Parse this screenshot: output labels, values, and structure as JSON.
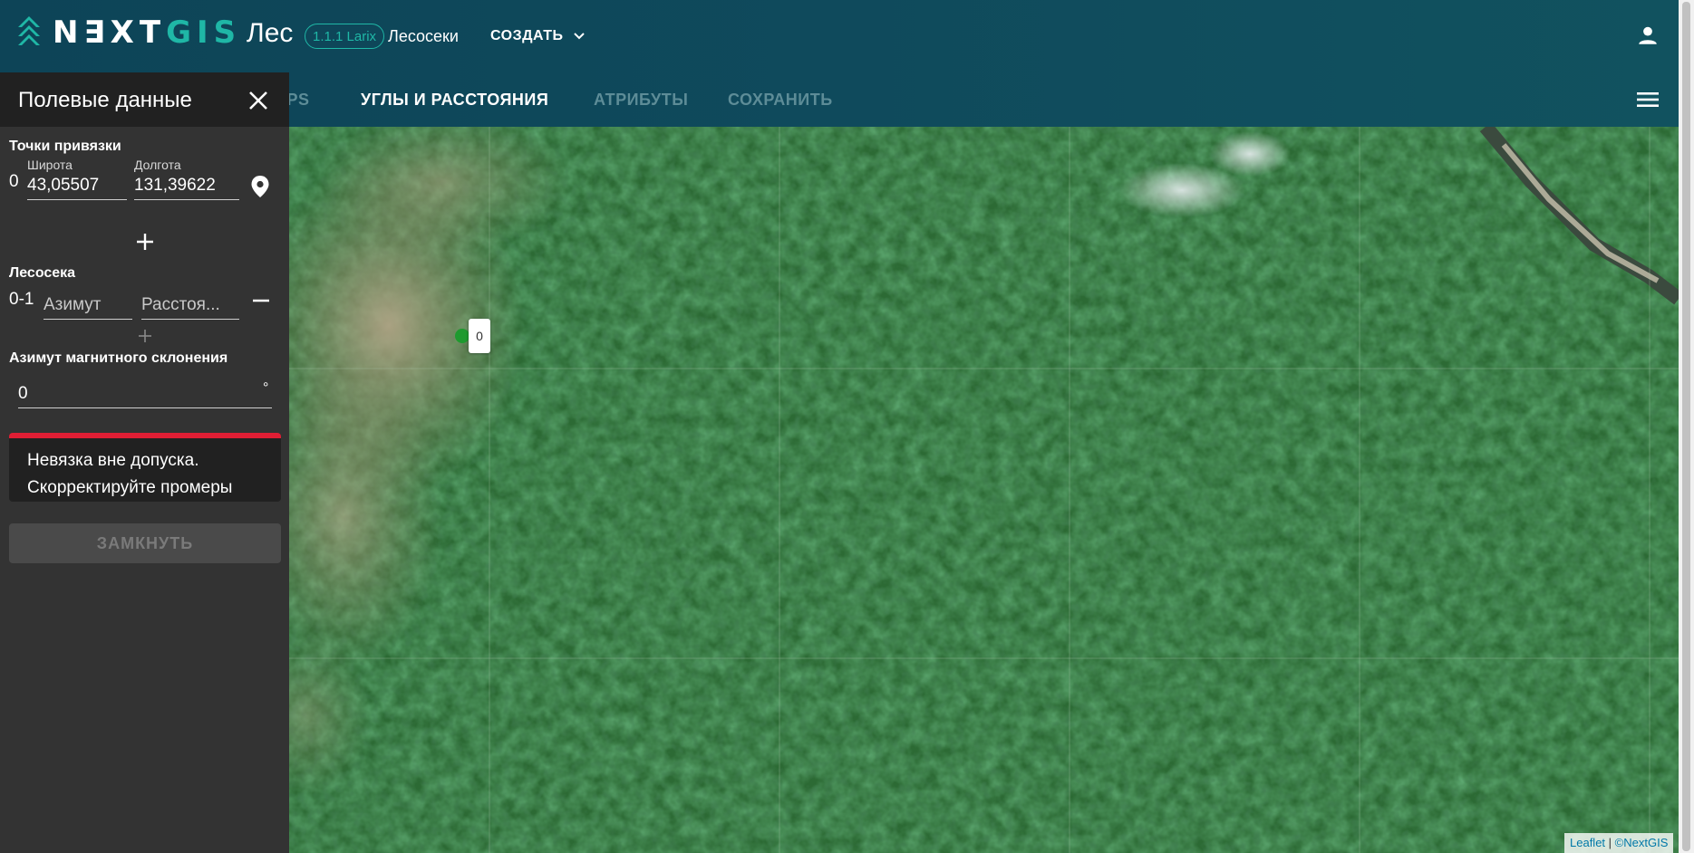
{
  "header": {
    "logo": {
      "part1": "N∃XT",
      "part2": "GIS",
      "icon": "nextgis-tree-icon"
    },
    "app_title": "Лес",
    "version": "1.1.1 Larix",
    "nav_link": "Лесосеки",
    "create_menu": {
      "label": "СОЗДАТЬ",
      "icon": "chevron-down-icon"
    },
    "user_icon": "account-icon",
    "menu_icon": "hamburger-menu-icon"
  },
  "tabs": [
    {
      "label": "GPS",
      "active": false
    },
    {
      "label": "УГЛЫ И РАССТОЯНИЯ",
      "active": true
    },
    {
      "label": "АТРИБУТЫ",
      "active": false
    },
    {
      "label": "СОХРАНИТЬ",
      "active": false
    }
  ],
  "panel": {
    "title": "Полевые данные",
    "close_icon": "close-icon",
    "anchor_points": {
      "label": "Точки привязки",
      "rows": [
        {
          "index": "0",
          "lat_label": "Широта",
          "lat_value": "43,05507",
          "lon_label": "Долгота",
          "lon_value": "131,39622",
          "icon": "map-marker-icon"
        }
      ],
      "add_icon": "plus-icon"
    },
    "plot": {
      "label": "Лесосека",
      "rows": [
        {
          "index": "0-1",
          "azimuth_placeholder": "Азимут",
          "distance_placeholder": "Расстоя...",
          "remove_icon": "minus-icon"
        }
      ],
      "add_icon": "plus-icon"
    },
    "declination": {
      "label": "Азимут магнитного склонения",
      "value": "0",
      "unit": "°"
    },
    "alert": {
      "line1": "Невязка вне допуска.",
      "line2": "Скорректируйте промеры",
      "color": "#e01e34"
    },
    "close_button": "ЗАМКНУТЬ"
  },
  "map": {
    "marker_label": "0",
    "attribution": {
      "leaflet": "Leaflet",
      "separator": " | ",
      "provider": "©NextGIS"
    }
  },
  "colors": {
    "accent": "#1fb7a6",
    "header": "#0f4a5c",
    "panel": "#333333",
    "error": "#e01e34"
  }
}
